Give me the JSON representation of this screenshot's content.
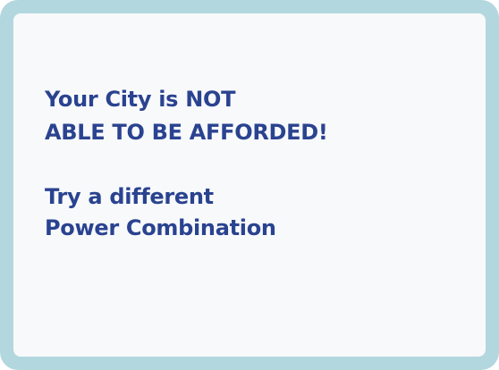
{
  "dialog": {
    "message_lines": [
      "Your City is NOT",
      "ABLE TO BE AFFORDED!",
      "Try a different",
      "Power Combination"
    ],
    "colors": {
      "frame": "#b3d7de",
      "panel": "#f8f9fb",
      "text": "#2a4390"
    }
  }
}
